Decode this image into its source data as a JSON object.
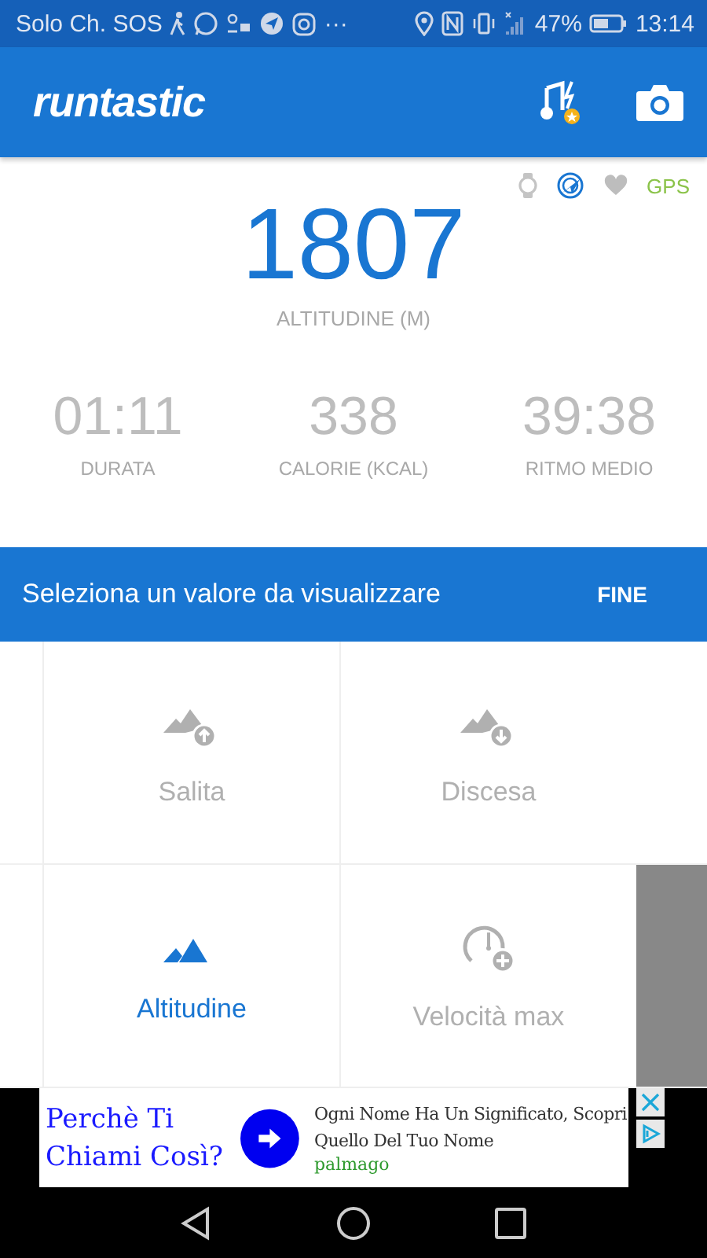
{
  "status_bar": {
    "carrier": "Solo Ch. SOS",
    "more": "···",
    "battery_text": "47%",
    "time": "13:14"
  },
  "app_bar": {
    "logo": "runtastic"
  },
  "sensors": {
    "gps": "GPS"
  },
  "main_metric": {
    "value": "1807",
    "label": "ALTITUDINE (M)"
  },
  "metrics": [
    {
      "value": "01:11",
      "label": "DURATA"
    },
    {
      "value": "338",
      "label": "CALORIE (KCAL)"
    },
    {
      "value": "39:38",
      "label": "RITMO MEDIO"
    }
  ],
  "select_bar": {
    "title": "Seleziona un valore da visualizzare",
    "action": "FINE"
  },
  "options": [
    {
      "kind": "ascent",
      "label": "Salita",
      "selected": false
    },
    {
      "kind": "descent",
      "label": "Discesa",
      "selected": false
    },
    {
      "kind": "altitude",
      "label": "Altitudine",
      "selected": true
    },
    {
      "kind": "maxspeed",
      "label": "Velocità max",
      "selected": false
    }
  ],
  "ad": {
    "headline": "Perchè Ti Chiami Così?",
    "text": "Ogni Nome Ha Un Significato, Scopri Quello Del Tuo Nome",
    "source": "palmago"
  }
}
